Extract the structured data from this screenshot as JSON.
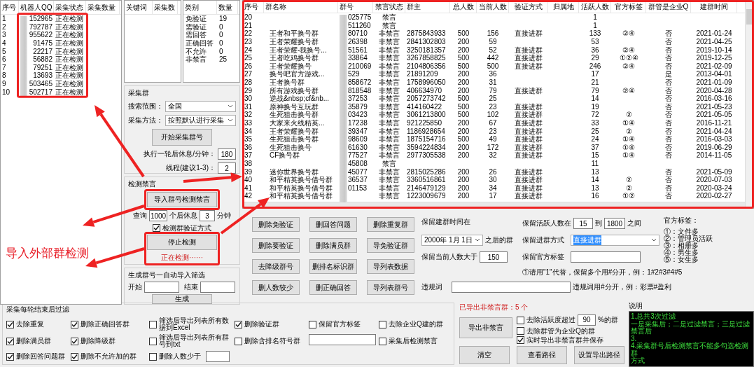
{
  "robot_list": {
    "columns": [
      "序号",
      "机器人QQ",
      "采集状态",
      "采集数量"
    ],
    "rows": [
      {
        "no": "1",
        "qq": "152965",
        "status": "正在检测"
      },
      {
        "no": "2",
        "qq": "792787",
        "status": "正在检测"
      },
      {
        "no": "3",
        "qq": "955622",
        "status": "正在检测"
      },
      {
        "no": "4",
        "qq": "91475",
        "status": "正在检测"
      },
      {
        "no": "5",
        "qq": "22217",
        "status": "正在检测"
      },
      {
        "no": "6",
        "qq": "56882",
        "status": "正在检测"
      },
      {
        "no": "7",
        "qq": "79251",
        "status": "正在检测"
      },
      {
        "no": "8",
        "qq": "13693",
        "status": "正在检测"
      },
      {
        "no": "9",
        "qq": "503465",
        "status": "正在检测"
      },
      {
        "no": "10",
        "qq": "502717",
        "status": "正在检测"
      }
    ]
  },
  "keyword_list": {
    "columns": [
      "关键词",
      "采集数"
    ]
  },
  "category_list": {
    "columns": [
      "类别",
      "数量"
    ],
    "rows": [
      {
        "name": "免验证",
        "count": "19"
      },
      {
        "name": "需验证",
        "count": "0"
      },
      {
        "name": "需回答",
        "count": "0"
      },
      {
        "name": "正确回答",
        "count": "0"
      },
      {
        "name": "不允许",
        "count": "0"
      },
      {
        "name": "非禁言",
        "count": "25"
      }
    ]
  },
  "collect_group": {
    "title": "采集群",
    "scope_label": "搜索范围：",
    "scope": "全国",
    "method_label": "采集方法：",
    "method": "按照默认进行采集",
    "start_button": "开始采集群号",
    "rest_label": "执行一轮后休息/分钟：",
    "rest": "180",
    "threads_label": "线程(建议1-3)：",
    "threads": "2"
  },
  "detect_group": {
    "title": "检测禁言",
    "import_button": "导入群号检测禁言",
    "query_label": "查询",
    "query": "1000",
    "after_label": "个后休息",
    "rest": "3",
    "minutes_label": "分钟",
    "verify_check": {
      "label": "检测群验证方式",
      "checked": true
    },
    "stop_button": "停止检测",
    "status": "正在检测······"
  },
  "generate_group": {
    "title": "生成群号一自动导入筛选",
    "start_label": "开始",
    "end_label": "结束",
    "button": "生成"
  },
  "group_table": {
    "columns": [
      "序号",
      "群名称",
      "群号",
      "禁言状态",
      "群主",
      "总人数",
      "当前人数",
      "验证方式",
      "归属地",
      "活跃人数",
      "官方标签",
      "群管是企业Q",
      "建群时间"
    ],
    "rows": [
      {
        "no": "20",
        "group_no": "025775",
        "ban": "禁言",
        "active": "1"
      },
      {
        "no": "21",
        "group_no": "511260",
        "ban": "禁言",
        "active": "1"
      },
      {
        "no": "22",
        "name": "王者和平换号群",
        "group_no": "80710",
        "ban": "非禁言",
        "owner": "2875843933",
        "total": "500",
        "current": "156",
        "verify": "直接进群",
        "active": "133",
        "tags": "②④",
        "enterprise": "否",
        "created": "2021-01-24"
      },
      {
        "no": "23",
        "name": "王者荣耀换号群",
        "group_no": "26398",
        "ban": "非禁言",
        "owner": "2841302803",
        "total": "200",
        "current": "59",
        "active": "53",
        "enterprise": "否",
        "created": "2021-04-25"
      },
      {
        "no": "24",
        "name": "王者荣耀-我换号...",
        "group_no": "51561",
        "ban": "非禁言",
        "owner": "3250181357",
        "total": "200",
        "current": "52",
        "verify": "直接进群",
        "active": "36",
        "tags": "②④",
        "enterprise": "否",
        "created": "2019-10-14"
      },
      {
        "no": "25",
        "name": "王者吃鸡换号群",
        "group_no": "33864",
        "ban": "非禁言",
        "owner": "3267858825",
        "total": "500",
        "current": "442",
        "verify": "直接进群",
        "active": "29",
        "tags": "①②④",
        "enterprise": "否",
        "created": "2019-12-25"
      },
      {
        "no": "26",
        "name": "王者荣耀换号",
        "group_no": "210069",
        "ban": "非禁言",
        "owner": "2104806356",
        "total": "500",
        "current": "500",
        "verify": "直接进群",
        "active": "246",
        "tags": "②④",
        "enterprise": "否",
        "created": "2021-02-09"
      },
      {
        "no": "27",
        "name": "换号吧官方游戏...",
        "group_no": "529",
        "ban": "非禁言",
        "owner": "21891209",
        "total": "200",
        "current": "36",
        "active": "17",
        "enterprise": "是",
        "created": "2013-04-01"
      },
      {
        "no": "28",
        "name": "王者换号群",
        "group_no": "858672",
        "ban": "非禁言",
        "owner": "1758996050",
        "total": "200",
        "current": "31",
        "active": "21",
        "enterprise": "否",
        "created": "2021-01-09"
      },
      {
        "no": "29",
        "name": "所有游戏换号群",
        "group_no": "818548",
        "ban": "非禁言",
        "owner": "406634970",
        "total": "200",
        "current": "79",
        "verify": "直接进群",
        "active": "79",
        "tags": "②④",
        "enterprise": "否",
        "created": "2020-04-28"
      },
      {
        "no": "30",
        "name": "逆战&nbsp;cf&nb...",
        "group_no": "37253",
        "ban": "非禁言",
        "owner": "2057273742",
        "total": "500",
        "current": "25",
        "active": "14",
        "enterprise": "否",
        "created": "2016-03-16"
      },
      {
        "no": "31",
        "name": "原神换号互玩群",
        "group_no": "35879",
        "ban": "非禁言",
        "owner": "414160422",
        "total": "500",
        "current": "23",
        "verify": "直接进群",
        "active": "19",
        "enterprise": "否",
        "created": "2021-05-23"
      },
      {
        "no": "32",
        "name": "生死狙击换号群",
        "group_no": "03423",
        "ban": "非禁言",
        "owner": "3061213800",
        "total": "500",
        "current": "102",
        "verify": "直接进群",
        "active": "72",
        "tags": "②",
        "enterprise": "否",
        "created": "2021-05-05"
      },
      {
        "no": "33",
        "name": "大家来火线精英...",
        "group_no": "17238",
        "ban": "非禁言",
        "owner": "921225850",
        "total": "200",
        "current": "67",
        "verify": "直接进群",
        "active": "33",
        "tags": "①④",
        "enterprise": "否",
        "created": "2016-11-21"
      },
      {
        "no": "34",
        "name": "王者荣耀换号群",
        "group_no": "39347",
        "ban": "非禁言",
        "owner": "1186928654",
        "total": "200",
        "current": "23",
        "verify": "直接进群",
        "active": "25",
        "tags": "②",
        "enterprise": "否",
        "created": "2021-04-24"
      },
      {
        "no": "35",
        "name": "生死狙击换号群",
        "group_no": "98609",
        "ban": "非禁言",
        "owner": "1875154716",
        "total": "500",
        "current": "49",
        "verify": "直接进群",
        "active": "24",
        "tags": "①④",
        "enterprise": "否",
        "created": "2016-03-03"
      },
      {
        "no": "36",
        "name": "生死狙击换号",
        "group_no": "61630",
        "ban": "非禁言",
        "owner": "3594224834",
        "total": "200",
        "current": "172",
        "verify": "直接进群",
        "active": "37",
        "tags": "①④",
        "enterprise": "否",
        "created": "2019-06-29"
      },
      {
        "no": "37",
        "name": "CF换号群",
        "group_no": "77527",
        "ban": "非禁言",
        "owner": "2977305538",
        "total": "200",
        "current": "32",
        "verify": "直接进群",
        "active": "15",
        "tags": "①④",
        "enterprise": "否",
        "created": "2014-11-05"
      },
      {
        "no": "38",
        "group_no": "45808",
        "ban": "禁言",
        "active": "11"
      },
      {
        "no": "39",
        "name": "迷你世界换号群",
        "group_no": "45077",
        "ban": "非禁言",
        "owner": "2815025286",
        "total": "200",
        "current": "26",
        "verify": "直接进群",
        "active": "13",
        "enterprise": "否",
        "created": "2021-05-09"
      },
      {
        "no": "40",
        "name": "和平精英换号借号群",
        "group_no": "36537",
        "ban": "非禁言",
        "owner": "3360516861",
        "total": "200",
        "current": "30",
        "verify": "直接进群",
        "active": "14",
        "tags": "②",
        "enterprise": "否",
        "created": "2020-07-03"
      },
      {
        "no": "41",
        "name": "和平精英换号借号群",
        "group_no": "01153",
        "ban": "非禁言",
        "owner": "2146479129",
        "total": "200",
        "current": "34",
        "verify": "直接进群",
        "active": "13",
        "tags": "②",
        "enterprise": "否",
        "created": "2020-03-24"
      },
      {
        "no": "42",
        "name": "和平精英换号借号群",
        "ban": "非禁言",
        "owner": "1223009679",
        "total": "200",
        "current": "17",
        "verify": "直接进群",
        "active": "16",
        "tags": "①②",
        "enterprise": "否",
        "created": "2020-02-27"
      }
    ]
  },
  "action_buttons": [
    "删除免验证",
    "删回答问题",
    "删除重复群",
    "删除要验证",
    "删除满员群",
    "导免验证群",
    "去降级群号",
    "删排名标识群",
    "导列表数据",
    "删人数较少",
    "删正确回答",
    "导列表群号"
  ],
  "retain_filters": {
    "created_label": "保留建群时间在",
    "created_date": "2000年 1月 1日",
    "after_label": "之后的群",
    "current_label": "保留当前人数大于",
    "current": "150",
    "active_label": "保留活跃人数在",
    "active_min": "15",
    "to_label": "到",
    "active_max": "1800",
    "between_label": "之间",
    "join_label": "保留进群方式",
    "join_method": "直接进群",
    "tags_label": "保留官方标签",
    "tags_hint": "①请用\"1\"代替，保留多个用#分开，例：1#2#3#4#5",
    "official_tags_title": "官方标签：",
    "official_tags": [
      "①：文件多",
      "②：管理员活跃",
      "③：相册多",
      "④：男生多",
      "⑤：女生多"
    ],
    "banned_words_label": "违规词",
    "banned_words_hint": "违规词用#分开，例：彩票#盈利"
  },
  "export_status": "已导出非禁言群：5 个",
  "round_filter": {
    "title": "采集每轮结束后过滤",
    "items": [
      {
        "kind": "checkbox",
        "label": "去除重复",
        "checked": true
      },
      {
        "kind": "checkbox",
        "label": "删除正确回答群",
        "checked": true
      },
      {
        "kind": "checkbox",
        "label": "筛选后导出列表所有数据到Excel",
        "checked": false
      },
      {
        "kind": "checkbox",
        "label": "删除验证群",
        "checked": true
      },
      {
        "kind": "checkbox",
        "label": "保留官方标签",
        "checked": false
      },
      {
        "kind": "checkbox",
        "label": "去除企业Q建的群",
        "checked": false
      },
      {
        "kind": "checkbox",
        "label": "删除满员群",
        "checked": true
      },
      {
        "kind": "checkbox",
        "label": "删除降级群",
        "checked": true
      },
      {
        "kind": "checkbox",
        "label": "筛选后导出列表所有群号到txt",
        "checked": false
      },
      {
        "kind": "checkbox",
        "label": "删除含排名符号群",
        "checked": false
      },
      {
        "kind": "field"
      },
      {
        "kind": "checkbox",
        "label": "采集后检测禁言",
        "checked": false
      },
      {
        "kind": "checkbox",
        "label": "删除回答问题群",
        "checked": true
      },
      {
        "kind": "checkbox",
        "label": "删除不允许加的群",
        "checked": true
      },
      {
        "kind": "checkbox_field",
        "label": "删除人数少于",
        "checked": false
      }
    ]
  },
  "export_controls": {
    "export_button": "导出非禁言",
    "clear_button": "清空",
    "view_path_button": "查看路径",
    "set_path_button": "设置导出路径",
    "active_check": {
      "label": "去除活跃度超过",
      "checked": false
    },
    "active_value": "90",
    "active_suffix": "%的群",
    "enterprise_check": {
      "label": "去除群管为企业Q的群",
      "checked": false
    },
    "realtime_check": {
      "label": "实时导出非禁言群并保存",
      "checked": true
    }
  },
  "notes": {
    "title": "说明",
    "lines": [
      "1.总共3次过滤",
      "一是采集后；二是过滤禁言；三是过滤禁言后",
      "3.",
      "4.采集群号后检测禁言不能多勾选检测群",
      "方式"
    ]
  },
  "annotations": {
    "label": "导入外部群检测"
  }
}
